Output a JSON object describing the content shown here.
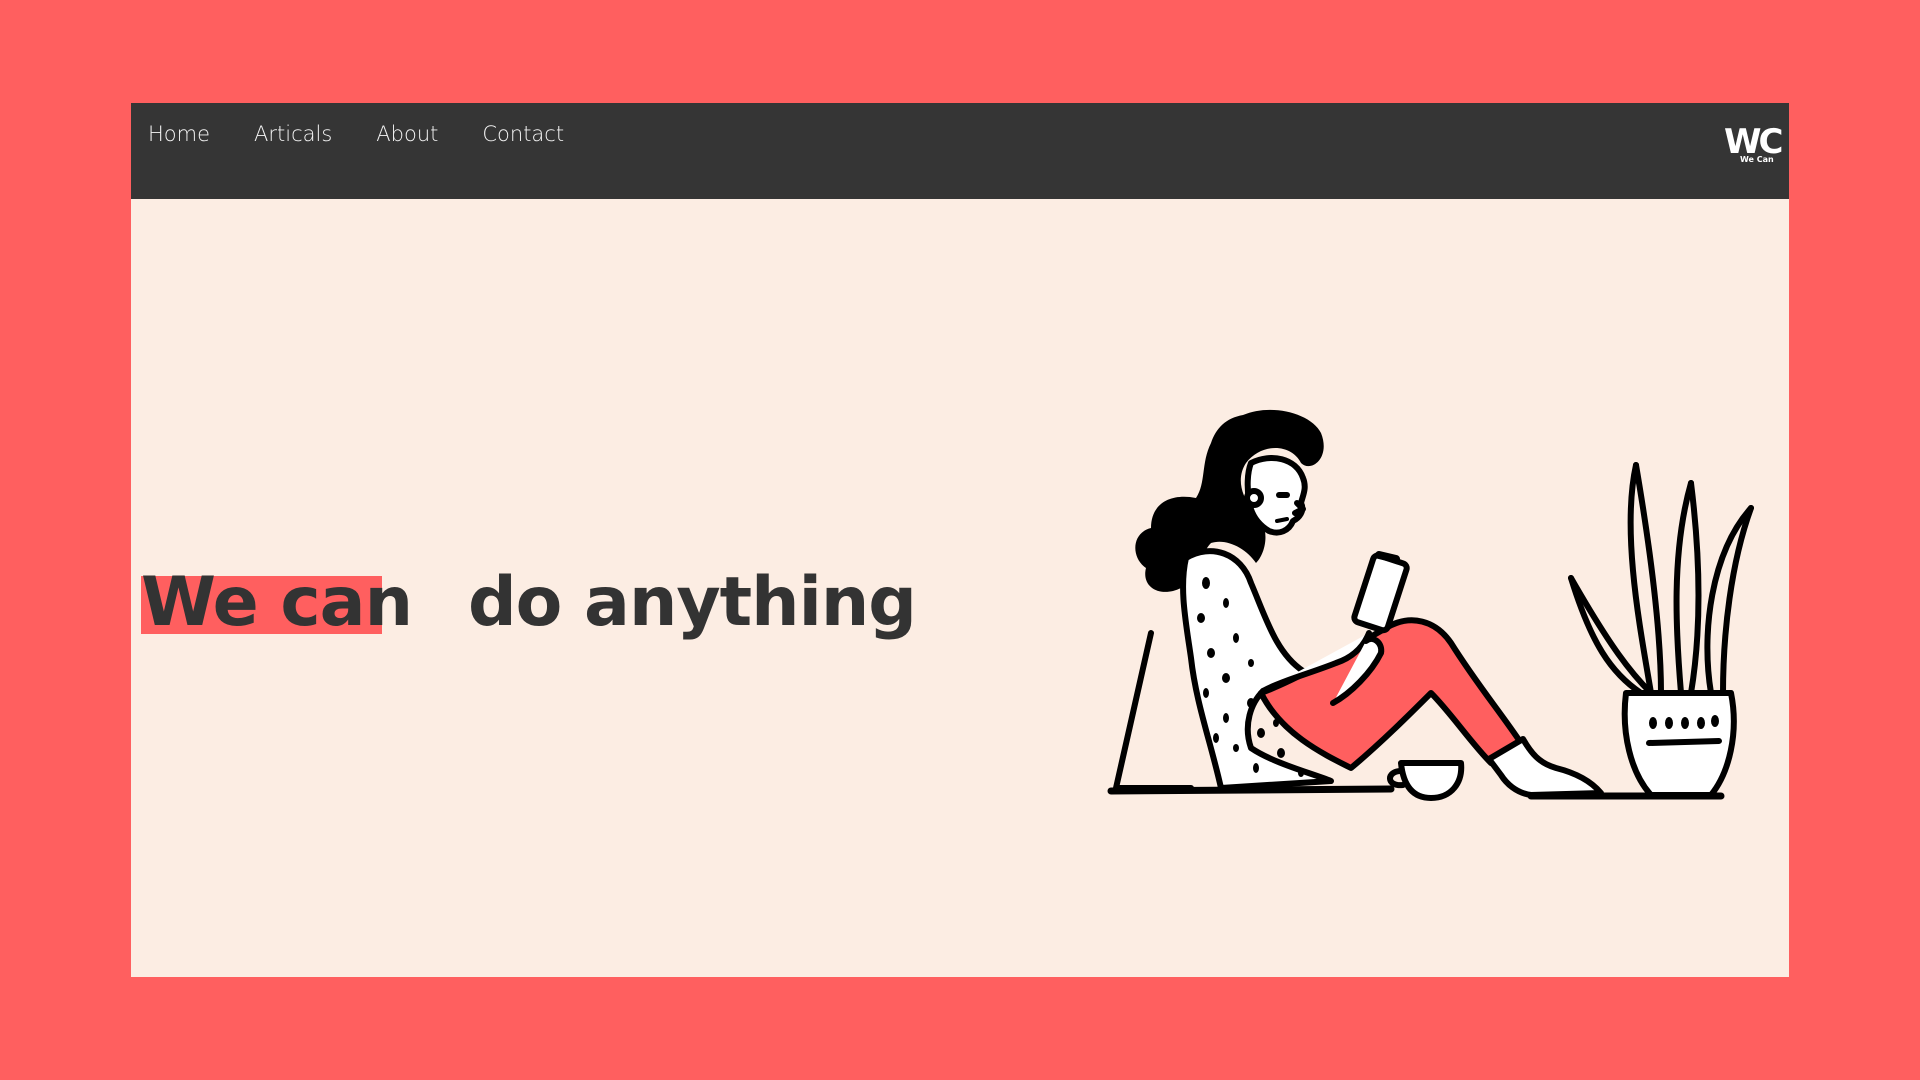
{
  "nav": {
    "links": [
      "Home",
      "Articals",
      "About",
      "Contact"
    ]
  },
  "logo": {
    "mark": "WC",
    "tagline": "We Can"
  },
  "hero": {
    "highlight": "We can",
    "rest": "do anything"
  },
  "colors": {
    "page_background": "#ff5f5f",
    "content_background": "#fcede3",
    "navbar": "#353535",
    "accent": "#ff5f5f",
    "text": "#333333"
  },
  "illustration": {
    "icon": "woman-reading-phone-illustration"
  }
}
